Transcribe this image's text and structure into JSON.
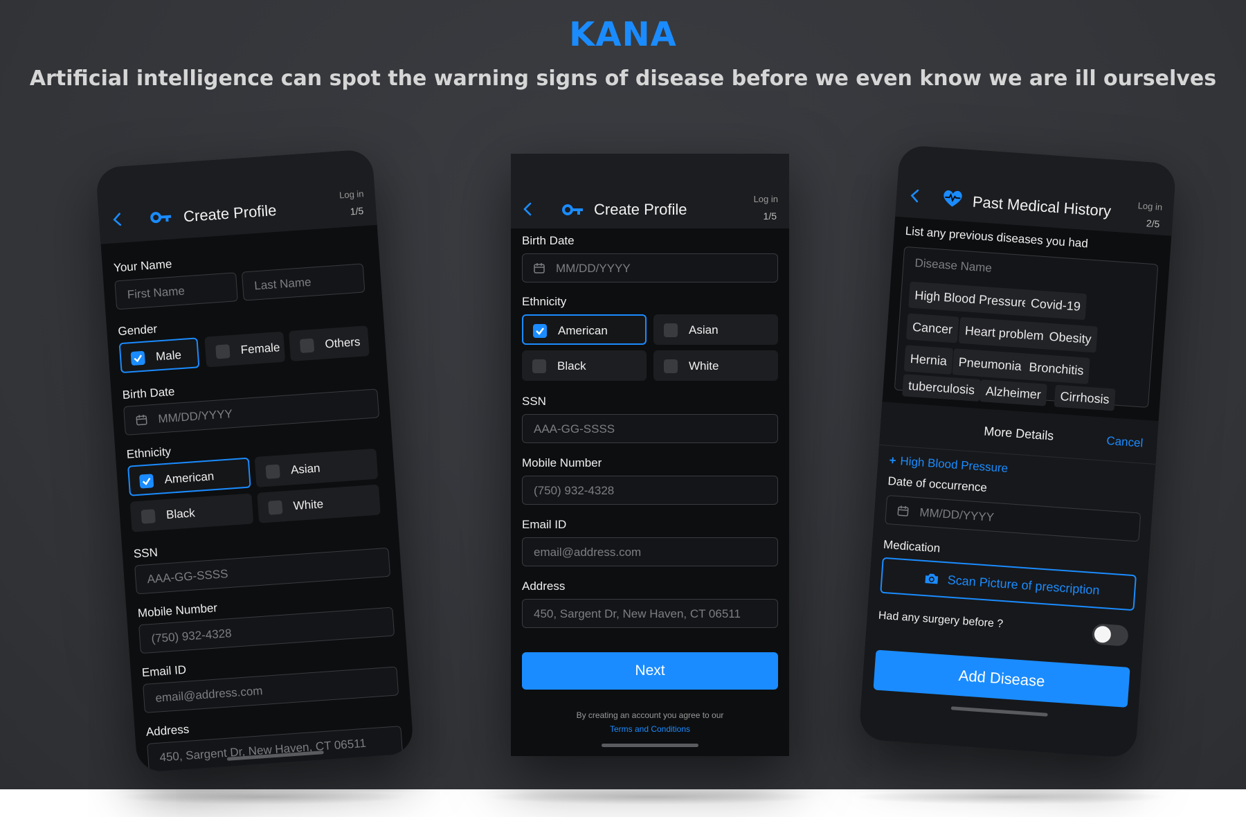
{
  "header": {
    "brand": "KANA",
    "tagline": "Artificial intelligence can spot the warning signs of disease before we even know we are ill ourselves"
  },
  "colors": {
    "accent": "#1a8cff",
    "background": "#323438",
    "phone": "#0d0e10"
  },
  "phone1": {
    "title": "Create Profile",
    "login": "Log in",
    "step": "1/5",
    "your_name_label": "Your Name",
    "first_name_placeholder": "First Name",
    "last_name_placeholder": "Last Name",
    "gender_label": "Gender",
    "gender_options": [
      "Male",
      "Female",
      "Others"
    ],
    "gender_selected": "Male",
    "birth_date_label": "Birth Date",
    "birth_date_placeholder": "MM/DD/YYYY",
    "ethnicity_label": "Ethnicity",
    "ethnicity_options": [
      "American",
      "Asian",
      "Black",
      "White"
    ],
    "ethnicity_selected": "American",
    "ssn_label": "SSN",
    "ssn_placeholder": "AAA-GG-SSSS",
    "mobile_label": "Mobile Number",
    "mobile_placeholder": "(750) 932-4328",
    "email_label": "Email ID",
    "email_placeholder": "email@address.com",
    "address_label": "Address",
    "address_placeholder": "450, Sargent Dr, New Haven, CT 06511"
  },
  "phone2": {
    "title": "Create Profile",
    "login": "Log in",
    "step": "1/5",
    "birth_date_label": "Birth Date",
    "birth_date_placeholder": "MM/DD/YYYY",
    "ethnicity_label": "Ethnicity",
    "ethnicity_options": [
      "American",
      "Asian",
      "Black",
      "White"
    ],
    "ethnicity_selected": "American",
    "ssn_label": "SSN",
    "ssn_placeholder": "AAA-GG-SSSS",
    "mobile_label": "Mobile Number",
    "mobile_placeholder": "(750) 932-4328",
    "email_label": "Email ID",
    "email_placeholder": "email@address.com",
    "address_label": "Address",
    "address_placeholder": "450, Sargent Dr, New Haven, CT 06511",
    "next_label": "Next",
    "terms_text": "By creating an account you agree to our",
    "terms_link": "Terms and Conditions"
  },
  "phone3": {
    "title": "Past Medical History",
    "login": "Log in",
    "step": "2/5",
    "instruction": "List any previous diseases you had",
    "disease_placeholder": "Disease Name",
    "diseases": [
      "High Blood Pressure",
      "Covid-19",
      "Cancer",
      "Heart problem",
      "Obesity",
      "Hernia",
      "Pneumonia",
      "Bronchitis",
      "tuberculosis",
      "Alzheimer",
      "Cirrhosis"
    ],
    "more_details_title": "More Details",
    "cancel_label": "Cancel",
    "selected_disease": "High Blood Pressure",
    "date_label": "Date of occurrence",
    "date_placeholder": "MM/DD/YYYY",
    "medication_label": "Medication",
    "scan_label": "Scan Picture of prescription",
    "surgery_label": "Had any surgery before ?",
    "surgery_toggle": "off",
    "add_label": "Add Disease"
  }
}
